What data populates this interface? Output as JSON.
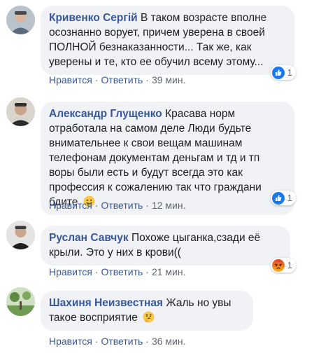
{
  "comments": [
    {
      "author": "Кривенко Сергій",
      "text": "В таком возрасте вполне осознанно ворует, причем уверена в своей ПОЛНОЙ безнаказанности... Так же, как уверены и те, кто ее обучил всему этому...",
      "like_label": "Нравится",
      "reply_label": "Ответить",
      "time": "39 мин.",
      "reaction_icon": "like-icon",
      "reaction_count": "1"
    },
    {
      "author": "Александр Глущенко",
      "text": "Красава норм отработала на самом деле Люди будьте внимательнее к свои вещам машинам телефонам документам деньгам и тд и тп воры были есть и будут всегда это как профессия к сожалению так что граждани бдите",
      "emoji": "smiling-face-emoji",
      "like_label": "Нравится",
      "reply_label": "Ответить",
      "time": "12 мин.",
      "reaction_icon": "like-icon",
      "reaction_count": "1"
    },
    {
      "author": "Руслан Савчук",
      "text": "Похоже цыганка,сзади её крыли. Это у них в крови((",
      "like_label": "Нравится",
      "reply_label": "Ответить",
      "time": "21 мин.",
      "reaction_icon": "angry-icon",
      "reaction_count": "1"
    },
    {
      "author": "Шахиня Неизвестная",
      "text": "Жаль но увы такое восприятие",
      "emoji": "thinking-face-emoji",
      "like_label": "Нравится",
      "reply_label": "Ответить",
      "time": "36 мин."
    }
  ],
  "colors": {
    "author": "#385898",
    "bubble": "#f0f2f5",
    "like_blue": "#1877f2",
    "angry_orange": "#e9710f"
  }
}
